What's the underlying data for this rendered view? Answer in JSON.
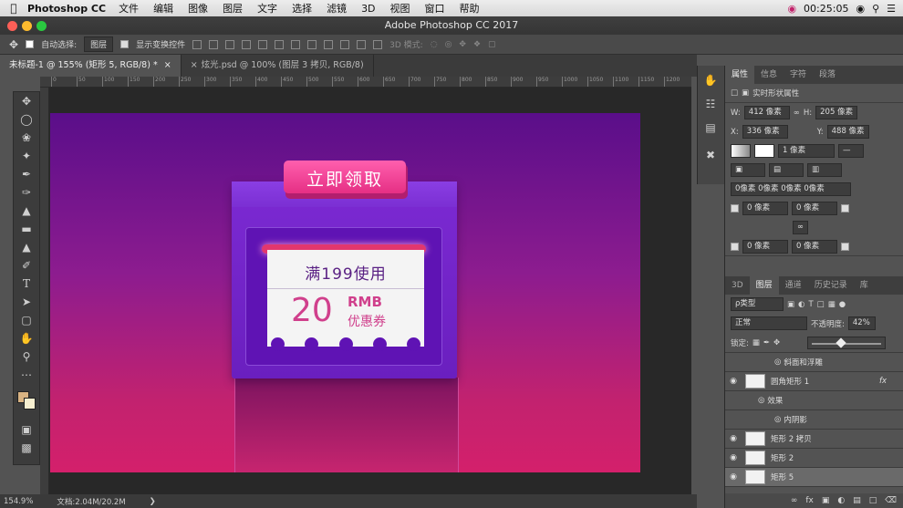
{
  "menubar": {
    "app": "Photoshop CC",
    "items": [
      "文件",
      "编辑",
      "图像",
      "图层",
      "文字",
      "选择",
      "滤镜",
      "3D",
      "视图",
      "窗口",
      "帮助"
    ],
    "clock": "00:25:05"
  },
  "window": {
    "title": "Adobe Photoshop CC 2017"
  },
  "options": {
    "auto_select_label": "自动选择:",
    "auto_select_value": "图层",
    "transform_label": "显示变换控件",
    "mode3d": "3D 模式:"
  },
  "tabs": [
    {
      "label": "未标题-1 @ 155% (矩形 5, RGB/8) *"
    },
    {
      "label": "炫光.psd @ 100% (图层 3 拷贝, RGB/8)"
    }
  ],
  "ruler": {
    "ticks": [
      "0",
      "50",
      "100",
      "150",
      "200",
      "250",
      "300",
      "350",
      "400",
      "450",
      "500",
      "550",
      "600",
      "650",
      "700",
      "750",
      "800",
      "850",
      "900",
      "950",
      "1000",
      "1050",
      "1100",
      "1150",
      "1200"
    ]
  },
  "artwork": {
    "tag": "立即领取",
    "line1": "满199使用",
    "amount": "20",
    "unit": "RMB",
    "subtitle": "优惠券"
  },
  "status": {
    "zoom": "154.9%",
    "doc": "文档:2.04M/20.2M"
  },
  "properties": {
    "tabs": [
      "属性",
      "信息",
      "字符",
      "段落"
    ],
    "title": "实时形状属性",
    "w_label": "W:",
    "w": "412 像素",
    "h_label": "H:",
    "h": "205 像素",
    "x_label": "X:",
    "x": "336 像素",
    "y_label": "Y:",
    "y": "488 像素",
    "stroke": "1 像素",
    "radii": "0像素 0像素 0像素 0像素",
    "r1": "0 像素",
    "r2": "0 像素",
    "r3": "0 像素",
    "r4": "0 像素"
  },
  "layers_panel": {
    "tabs": [
      "3D",
      "图层",
      "通道",
      "历史记录",
      "库"
    ],
    "filter": "ρ类型",
    "blend": "正常",
    "opacity_label": "不透明度:",
    "opacity": "42%",
    "opacity_value": 0.42,
    "lock_label": "锁定:",
    "rows": [
      {
        "name": "斜面和浮雕",
        "indent": 2
      },
      {
        "name": "圆角矩形 1",
        "fx": "fx",
        "indent": 0
      },
      {
        "name": "效果",
        "indent": 1
      },
      {
        "name": "内阴影",
        "indent": 2
      },
      {
        "name": "矩形 2 拷贝",
        "indent": 0
      },
      {
        "name": "矩形 2",
        "indent": 0
      },
      {
        "name": "矩形 5",
        "indent": 0,
        "selected": true
      }
    ]
  },
  "colors": {
    "accent": "#e13d8e",
    "purple": "#6e22b0",
    "fg": "#d9b382",
    "bg": "#f2f2f2"
  }
}
